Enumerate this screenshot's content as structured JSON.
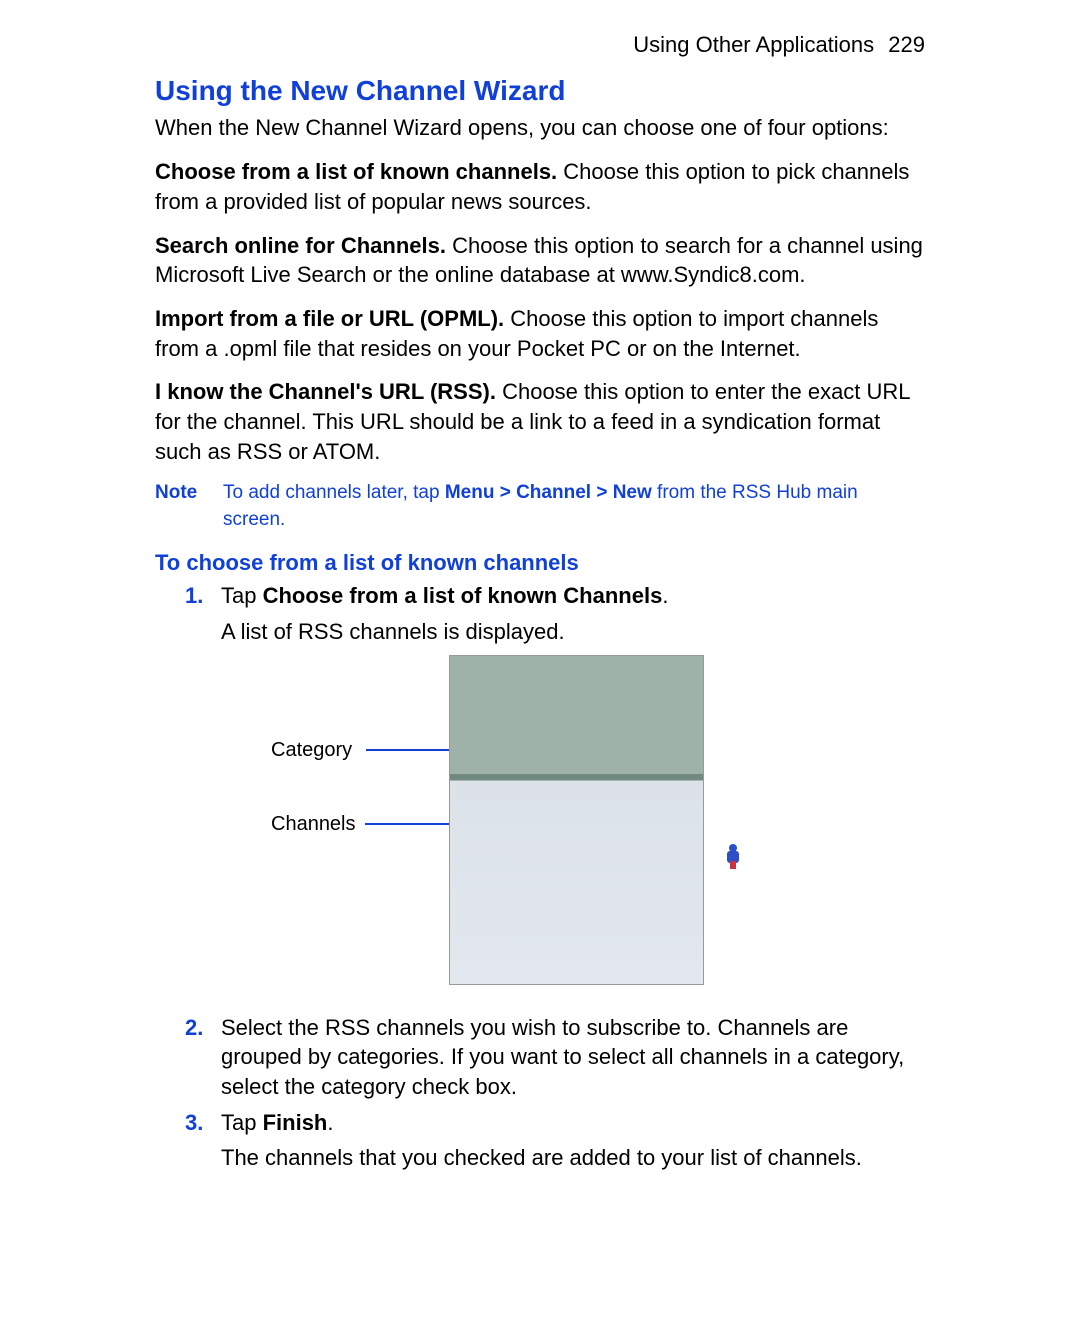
{
  "header": {
    "section": "Using Other Applications",
    "page": "229"
  },
  "title": "Using the New Channel Wizard",
  "intro": "When the New Channel Wizard opens, you can choose one of four options:",
  "options": [
    {
      "label": "Choose from a list of known channels.",
      "text": " Choose this option to pick channels from a provided list of popular news sources."
    },
    {
      "label": "Search online for Channels.",
      "text": " Choose this option to search for a channel using Microsoft Live Search or the online database at www.Syndic8.com."
    },
    {
      "label": "Import from a file or URL (OPML).",
      "text": " Choose this option to import channels from a .opml file that resides on your Pocket PC or on the Internet."
    },
    {
      "label": "I know the Channel's URL (RSS).",
      "text": " Choose this option to enter the exact URL for the channel. This URL should be a link to a feed in a syndication format such as RSS or ATOM."
    }
  ],
  "note": {
    "label": "Note",
    "pre": "To add channels later, tap ",
    "bold": "Menu > Channel > New",
    "post": " from the RSS Hub main screen."
  },
  "subhead": "To choose from a list of known channels",
  "steps": {
    "s1": {
      "num": "1.",
      "pre": "Tap ",
      "bold": "Choose from a list of known Channels",
      "post": ".",
      "sub": "A list of RSS channels is displayed."
    },
    "callouts": {
      "category": "Category",
      "channels": "Channels"
    },
    "s2": {
      "num": "2.",
      "text": "Select the RSS channels you wish to subscribe to. Channels are grouped by categories. If you want to select all channels in a category, select the category check box."
    },
    "s3": {
      "num": "3.",
      "pre": "Tap ",
      "bold": "Finish",
      "post": ".",
      "sub": "The channels that you checked are added to your list of channels."
    }
  }
}
